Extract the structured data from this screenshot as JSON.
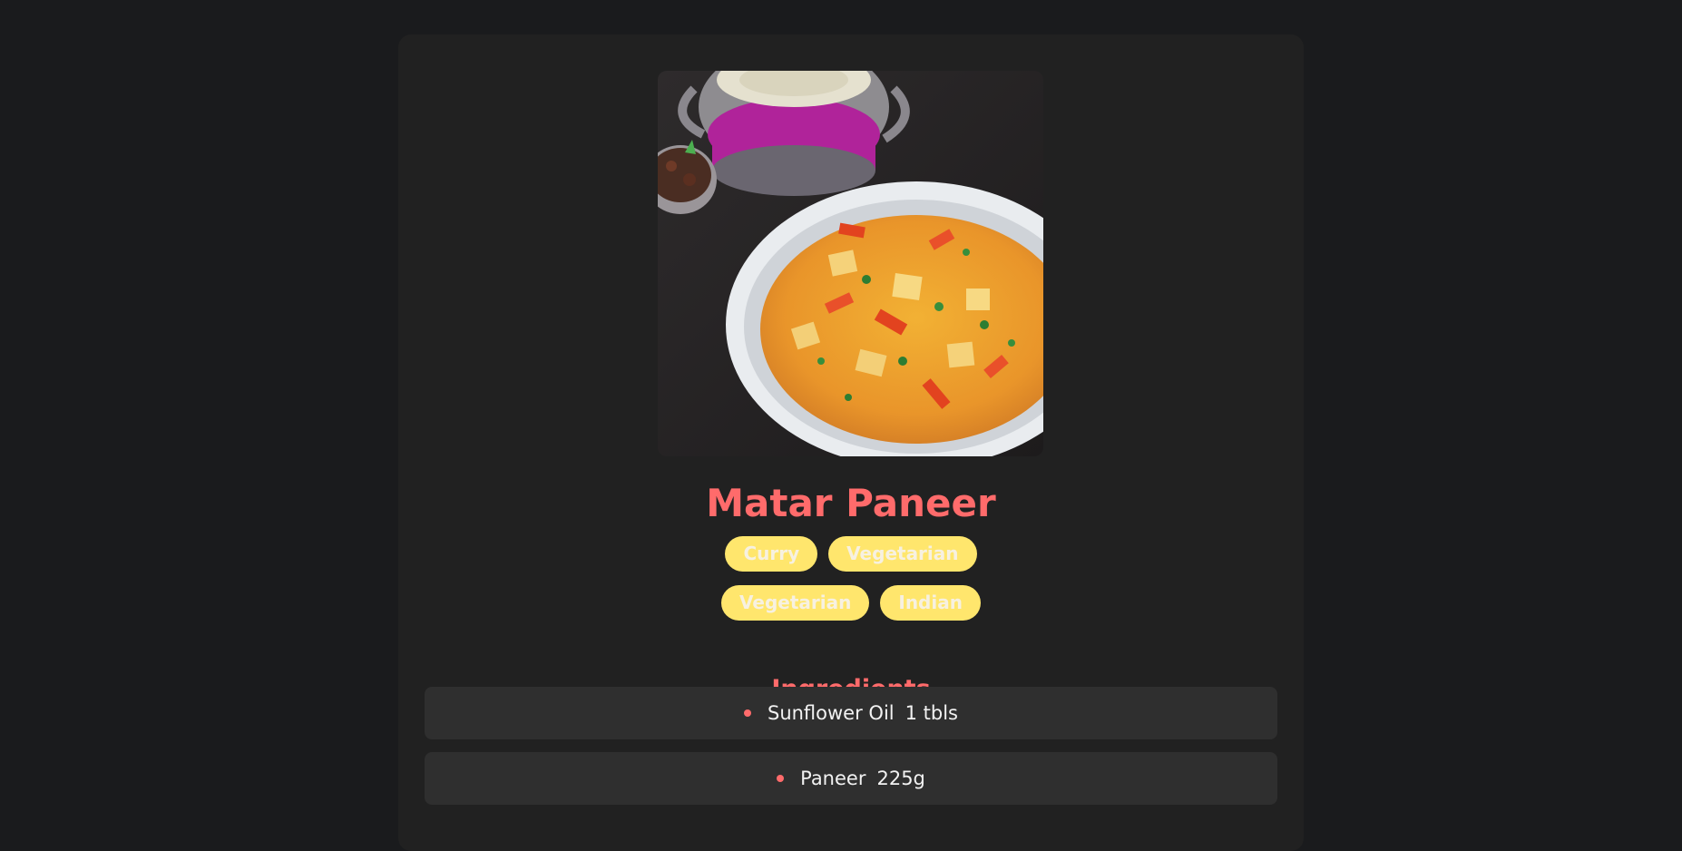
{
  "recipe": {
    "title": "Matar Paneer",
    "image_alt": "Matar Paneer dish photo",
    "tags_row1": [
      "Curry",
      "Vegetarian"
    ],
    "tags_row2": [
      "Vegetarian",
      "Indian"
    ],
    "ingredients_heading": "Ingredients",
    "ingredients": [
      {
        "name": "Sunflower Oil",
        "measure": "1 tbls"
      },
      {
        "name": "Paneer",
        "measure": "225g"
      }
    ]
  },
  "colors": {
    "page_bg": "#1a1b1d",
    "card_bg": "#212121",
    "accent": "#ff6b6b",
    "tag_bg": "#ffe66d",
    "ingredient_bg": "#2f2f2f"
  }
}
